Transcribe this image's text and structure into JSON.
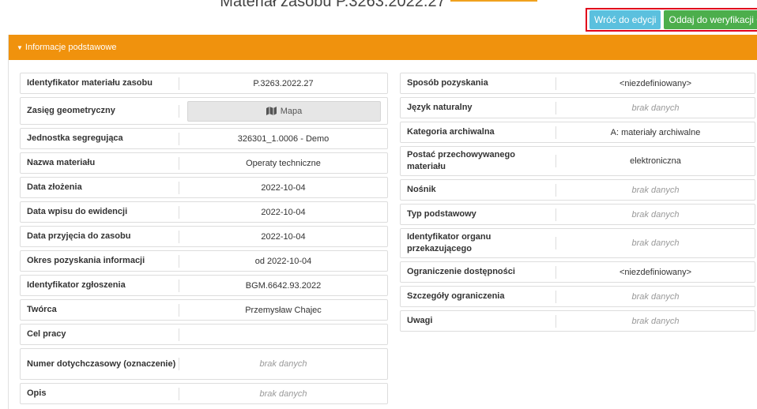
{
  "header": {
    "title": "Materiał zasobu P.3263.2022.27"
  },
  "actions": {
    "back_label": "Wróć do edycji",
    "verify_label": "Oddaj do weryfikacji ODGiK"
  },
  "panel": {
    "title": "Informacje podstawowe"
  },
  "left_rows": [
    {
      "label": "Identyfikator materiału zasobu",
      "value": "P.3263.2022.27"
    },
    {
      "label": "Zasięg geometryczny",
      "value": "Mapa"
    },
    {
      "label": "Jednostka segregująca",
      "value": "326301_1.0006 - Demo"
    },
    {
      "label": "Nazwa materiału",
      "value": "Operaty techniczne"
    },
    {
      "label": "Data złożenia",
      "value": "2022-10-04"
    },
    {
      "label": "Data wpisu do ewidencji",
      "value": "2022-10-04"
    },
    {
      "label": "Data przyjęcia do zasobu",
      "value": "2022-10-04"
    },
    {
      "label": "Okres pozyskania informacji",
      "value": "od 2022-10-04"
    },
    {
      "label": "Identyfikator zgłoszenia",
      "value": "BGM.6642.93.2022"
    },
    {
      "label": "Twórca",
      "value": "Przemysław Chajec"
    },
    {
      "label": "Cel pracy",
      "value": ""
    },
    {
      "label": "Numer dotychczasowy (oznaczenie)",
      "value": "brak danych"
    },
    {
      "label": "Opis",
      "value": "brak danych"
    }
  ],
  "right_rows": [
    {
      "label": "Sposób pozyskania",
      "value": "<niezdefiniowany>"
    },
    {
      "label": "Język naturalny",
      "value": "brak danych"
    },
    {
      "label": "Kategoria archiwalna",
      "value": "A: materiały archiwalne"
    },
    {
      "label": "Postać przechowywanego materiału",
      "value": "elektroniczna"
    },
    {
      "label": "Nośnik",
      "value": "brak danych"
    },
    {
      "label": "Typ podstawowy",
      "value": "brak danych"
    },
    {
      "label": "Identyfikator organu przekazującego",
      "value": "brak danych"
    },
    {
      "label": "Ograniczenie dostępności",
      "value": "<niezdefiniowany>"
    },
    {
      "label": "Szczegóły ograniczenia",
      "value": "brak danych"
    },
    {
      "label": "Uwagi",
      "value": "brak danych"
    }
  ]
}
